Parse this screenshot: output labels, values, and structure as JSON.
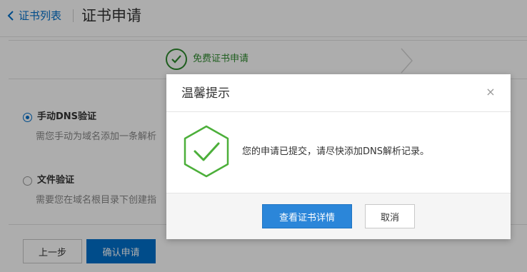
{
  "header": {
    "back_label": "证书列表",
    "title": "证书申请"
  },
  "stepbar": {
    "step_label": "免费证书申请"
  },
  "options": [
    {
      "title": "手动DNS验证",
      "desc": "需您手动为域名添加一条解析",
      "selected": true
    },
    {
      "title": "文件验证",
      "desc": "需要您在域名根目录下创建指",
      "selected": false
    }
  ],
  "footer": {
    "prev_label": "上一步",
    "confirm_label": "确认申请"
  },
  "dialog": {
    "title": "温馨提示",
    "close_glyph": "×",
    "message": "您的申请已提交，请尽快添加DNS解析记录。",
    "detail_label": "查看证书详情",
    "cancel_label": "取消"
  },
  "colors": {
    "accent": "#0070cc",
    "success": "#2e8b2e",
    "dialog_icon": "#4caf3a"
  }
}
